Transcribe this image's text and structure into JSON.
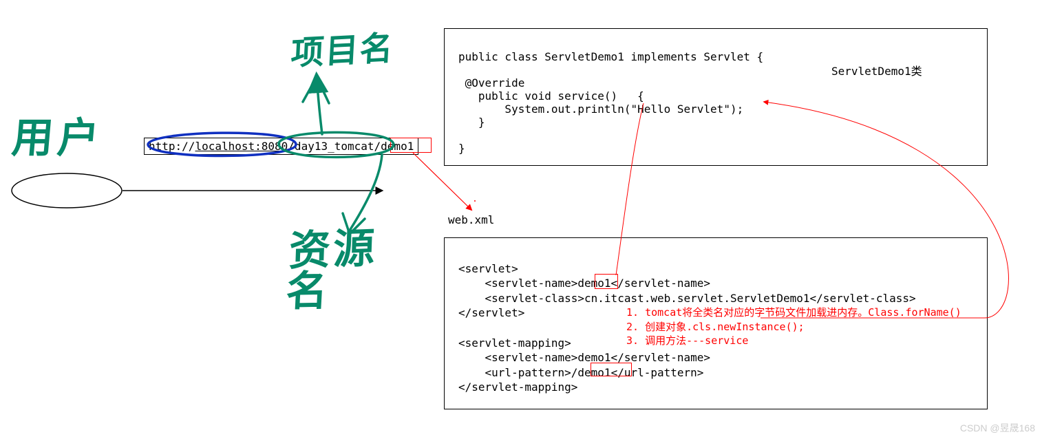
{
  "handwriting": {
    "user_label": "用户",
    "project_name": "项目名",
    "resource_label": "资源名"
  },
  "url": {
    "prefix": "http://",
    "host_port": "localhost:8080",
    "path1": "/day13_tomcat",
    "path2": "/demo1",
    "full": "http://localhost:8080/day13_tomcat/demo1"
  },
  "code_box": {
    "line1": "public class ServletDemo1 implements Servlet {",
    "line2": " @Override",
    "line3": "   public void service()   {",
    "line4": "       System.out.println(\"Hello Servlet\");",
    "line5": "   }",
    "line6": "}",
    "label": "ServletDemo1类"
  },
  "web_xml_label": "web.xml",
  "xml_box": {
    "l1": "<servlet>",
    "l2": "    <servlet-name>demo1</servlet-name>",
    "l3": "    <servlet-class>cn.itcast.web.servlet.ServletDemo1</servlet-class>",
    "l4": "</servlet>",
    "l5": "<servlet-mapping>",
    "l6": "    <servlet-name>demo1</servlet-name>",
    "l7a": "    <url-pattern>",
    "l7b": "/demo1",
    "l7c": "</url-pattern>",
    "l8": "</servlet-mapping>"
  },
  "red_notes": {
    "n1": "1. tomcat将全类名对应的字节码文件加载进内存。Class.forName()",
    "n2": "2. 创建对象.cls.newInstance();",
    "n3": "3. 调用方法---service"
  },
  "watermark": "CSDN @昱晟168"
}
